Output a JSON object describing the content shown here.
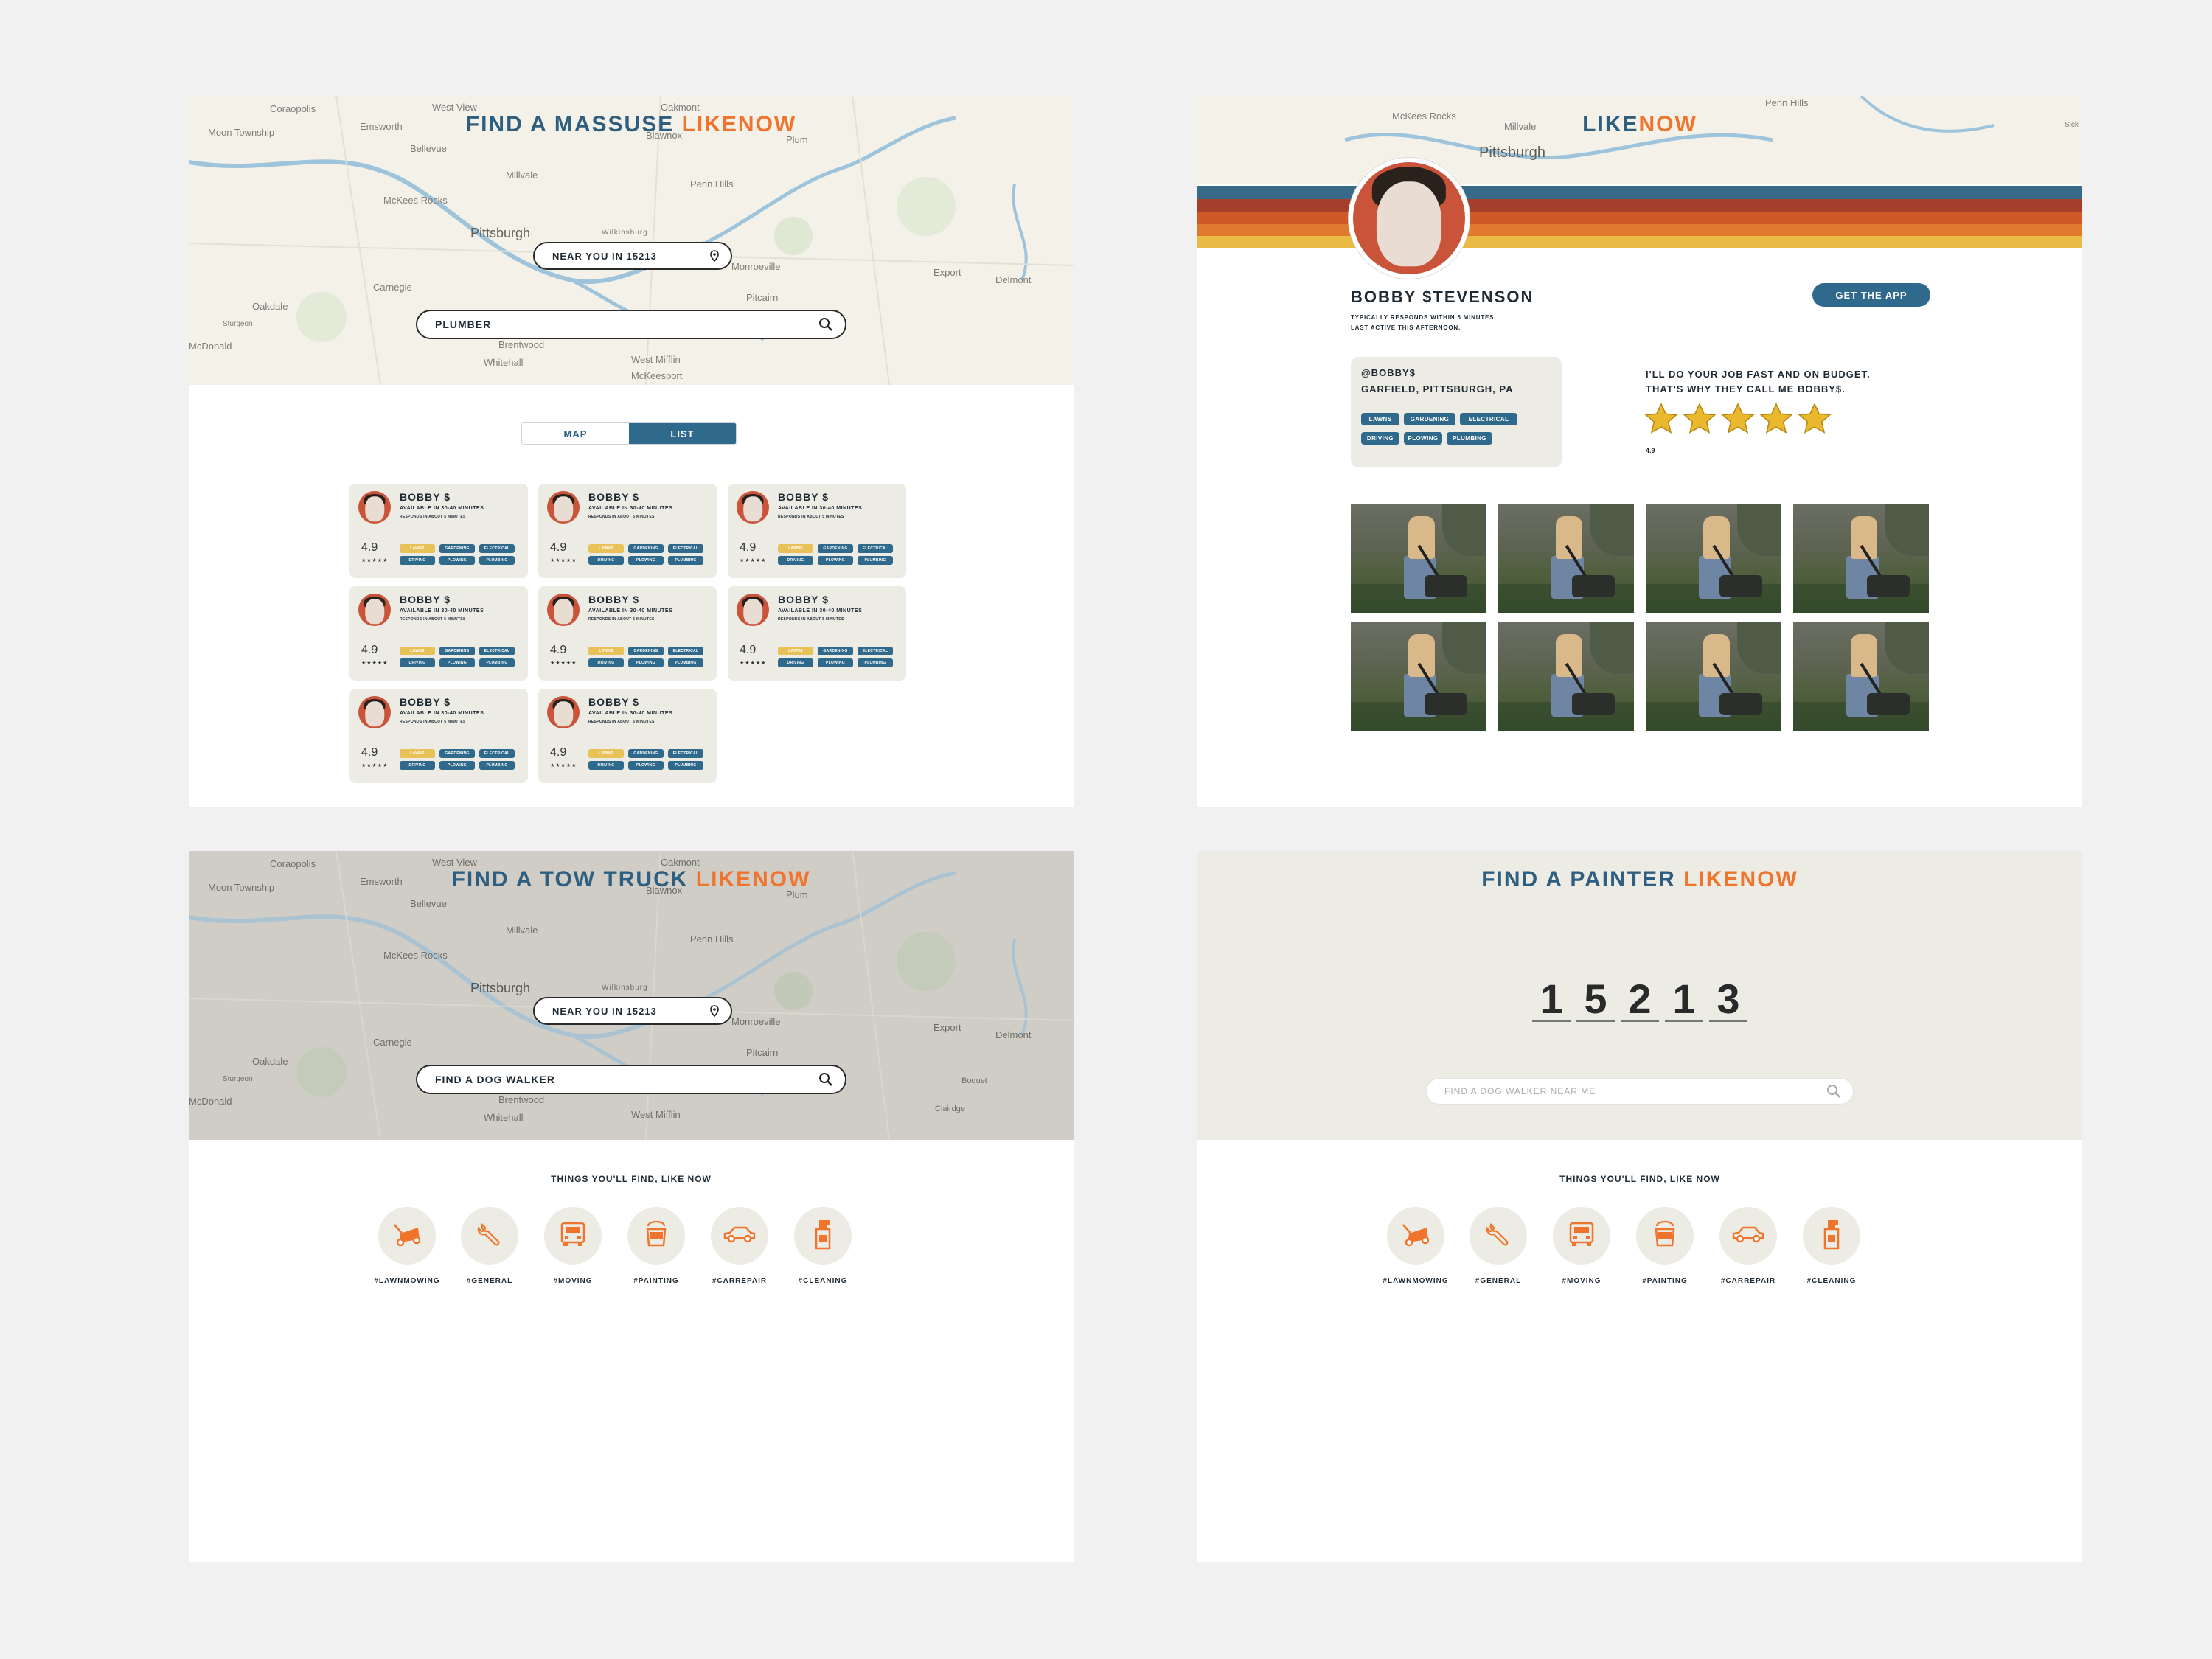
{
  "colors": {
    "brand_blue": "#2f5f80",
    "brand_orange": "#f0742c",
    "tag_blue": "#2f6a8c",
    "tag_yellow": "#e8c259",
    "card_bg": "#ecebe4"
  },
  "map_labels": [
    "Coraopolis",
    "West View",
    "Oakmont",
    "Moon Township",
    "Emsworth",
    "Bellevue",
    "Blawnox",
    "Plum",
    "Millvale",
    "Penn Hills",
    "McKees Rocks",
    "Pittsburgh",
    "Wilkinsburg",
    "Monroeville",
    "Carnegie",
    "Export",
    "Oakdale",
    "Delmont",
    "Sturgeon",
    "Pitcairn",
    "McDonald",
    "Brentwood",
    "Whitehall",
    "West Mifflin",
    "McKeesport",
    "Clairdge",
    "Boquet",
    "Sick"
  ],
  "p1": {
    "title_a": "FIND A MASSUSE ",
    "title_b": "LIKENOW",
    "location": "NEAR YOU IN 15213",
    "search_value": "PLUMBER",
    "toggle": [
      "MAP",
      "LIST"
    ],
    "cards": [
      {
        "name": "BOBBY $",
        "availability": "AVAILABLE IN 30-40 MINUTES",
        "responds": "RESPONDS IN ABOUT 5 MINUTES",
        "rating": "4.9",
        "stars": "★★★★★",
        "tags": [
          "LAWNS",
          "GARDENING",
          "ELECTRICAL",
          "DRIVING",
          "PLOWING",
          "PLUMBING"
        ]
      },
      {
        "name": "BOBBY $",
        "availability": "AVAILABLE IN 30-40 MINUTES",
        "responds": "RESPONDS IN ABOUT 5 MINUTES",
        "rating": "4.9",
        "stars": "★★★★★",
        "tags": [
          "LAWNS",
          "GARDENING",
          "ELECTRICAL",
          "DRIVING",
          "PLOWING",
          "PLUMBING"
        ]
      },
      {
        "name": "BOBBY $",
        "availability": "AVAILABLE IN 30-40 MINUTES",
        "responds": "RESPONDS IN ABOUT 5 MINUTES",
        "rating": "4.9",
        "stars": "★★★★★",
        "tags": [
          "LAWNS",
          "GARDENING",
          "ELECTRICAL",
          "DRIVING",
          "PLOWING",
          "PLUMBING"
        ]
      },
      {
        "name": "BOBBY $",
        "availability": "AVAILABLE IN 30-40 MINUTES",
        "responds": "RESPONDS IN ABOUT 5 MINUTES",
        "rating": "4.9",
        "stars": "★★★★★",
        "tags": [
          "LAWNS",
          "GARDENING",
          "ELECTRICAL",
          "DRIVING",
          "PLOWING",
          "PLUMBING"
        ]
      },
      {
        "name": "BOBBY $",
        "availability": "AVAILABLE IN 30-40 MINUTES",
        "responds": "RESPONDS IN ABOUT 5 MINUTES",
        "rating": "4.9",
        "stars": "★★★★★",
        "tags": [
          "LAWNS",
          "GARDENING",
          "ELECTRICAL",
          "DRIVING",
          "PLOWING",
          "PLUMBING"
        ]
      },
      {
        "name": "BOBBY $",
        "availability": "AVAILABLE IN 30-40 MINUTES",
        "responds": "RESPONDS IN ABOUT 5 MINUTES",
        "rating": "4.9",
        "stars": "★★★★★",
        "tags": [
          "LAWNS",
          "GARDENING",
          "ELECTRICAL",
          "DRIVING",
          "PLOWING",
          "PLUMBING"
        ]
      },
      {
        "name": "BOBBY $",
        "availability": "AVAILABLE IN 30-40 MINUTES",
        "responds": "RESPONDS IN ABOUT 5 MINUTES",
        "rating": "4.9",
        "stars": "★★★★★",
        "tags": [
          "LAWNS",
          "GARDENING",
          "ELECTRICAL",
          "DRIVING",
          "PLOWING",
          "PLUMBING"
        ]
      },
      {
        "name": "BOBBY $",
        "availability": "AVAILABLE IN 30-40 MINUTES",
        "responds": "RESPONDS IN ABOUT 5 MINUTES",
        "rating": "4.9",
        "stars": "★★★★★",
        "tags": [
          "LAWNS",
          "GARDENING",
          "ELECTRICAL",
          "DRIVING",
          "PLOWING",
          "PLUMBING"
        ]
      }
    ]
  },
  "p2": {
    "logo_a": "LIKE",
    "logo_b": "NOW",
    "name": "BOBBY $TEVENSON",
    "responds": "TYPICALLY RESPONDS WITHIN 5 MINUTES.",
    "last_active": "LAST ACTIVE THIS AFTERNOON.",
    "cta": "GET THE APP",
    "handle": "@BOBBY$",
    "location": "GARFIELD, PITTSBURGH, PA",
    "tags": [
      "LAWNS",
      "GARDENING",
      "ELECTRICAL",
      "DRIVING",
      "PLOWING",
      "PLUMBING"
    ],
    "quote_1": "I'LL DO YOUR JOB FAST AND ON BUDGET.",
    "quote_2": "THAT'S WHY THEY CALL ME BOBBY$.",
    "stars": 5,
    "rating": "4.9",
    "stripe_colors": [
      "#3a6a8a",
      "#a33f2b",
      "#cf5a28",
      "#e07a2f",
      "#e9bb45"
    ]
  },
  "p3": {
    "title_a": "FIND A TOW TRUCK ",
    "title_b": "LIKENOW",
    "location": "NEAR YOU IN 15213",
    "search_value": "FIND A DOG WALKER",
    "section": "THINGS YOU'LL FIND, LIKE NOW",
    "categories": [
      {
        "label": "#LAWNMOWING",
        "icon": "lawnmower-icon"
      },
      {
        "label": "#GENERAL",
        "icon": "wrench-icon"
      },
      {
        "label": "#MOVING",
        "icon": "truck-icon"
      },
      {
        "label": "#PAINTING",
        "icon": "paint-bucket-icon"
      },
      {
        "label": "#CARREPAIR",
        "icon": "car-icon"
      },
      {
        "label": "#CLEANING",
        "icon": "spray-bottle-icon"
      }
    ]
  },
  "p4": {
    "title_a": "FIND A PAINTER ",
    "title_b": "LIKENOW",
    "digits": [
      "1",
      "5",
      "2",
      "1",
      "3"
    ],
    "search_placeholder": "FIND A DOG WALKER NEAR ME",
    "section": "THINGS YOU'LL FIND, LIKE NOW",
    "categories": [
      {
        "label": "#LAWNMOWING",
        "icon": "lawnmower-icon"
      },
      {
        "label": "#GENERAL",
        "icon": "wrench-icon"
      },
      {
        "label": "#MOVING",
        "icon": "truck-icon"
      },
      {
        "label": "#PAINTING",
        "icon": "paint-bucket-icon"
      },
      {
        "label": "#CARREPAIR",
        "icon": "car-icon"
      },
      {
        "label": "#CLEANING",
        "icon": "spray-bottle-icon"
      }
    ]
  }
}
